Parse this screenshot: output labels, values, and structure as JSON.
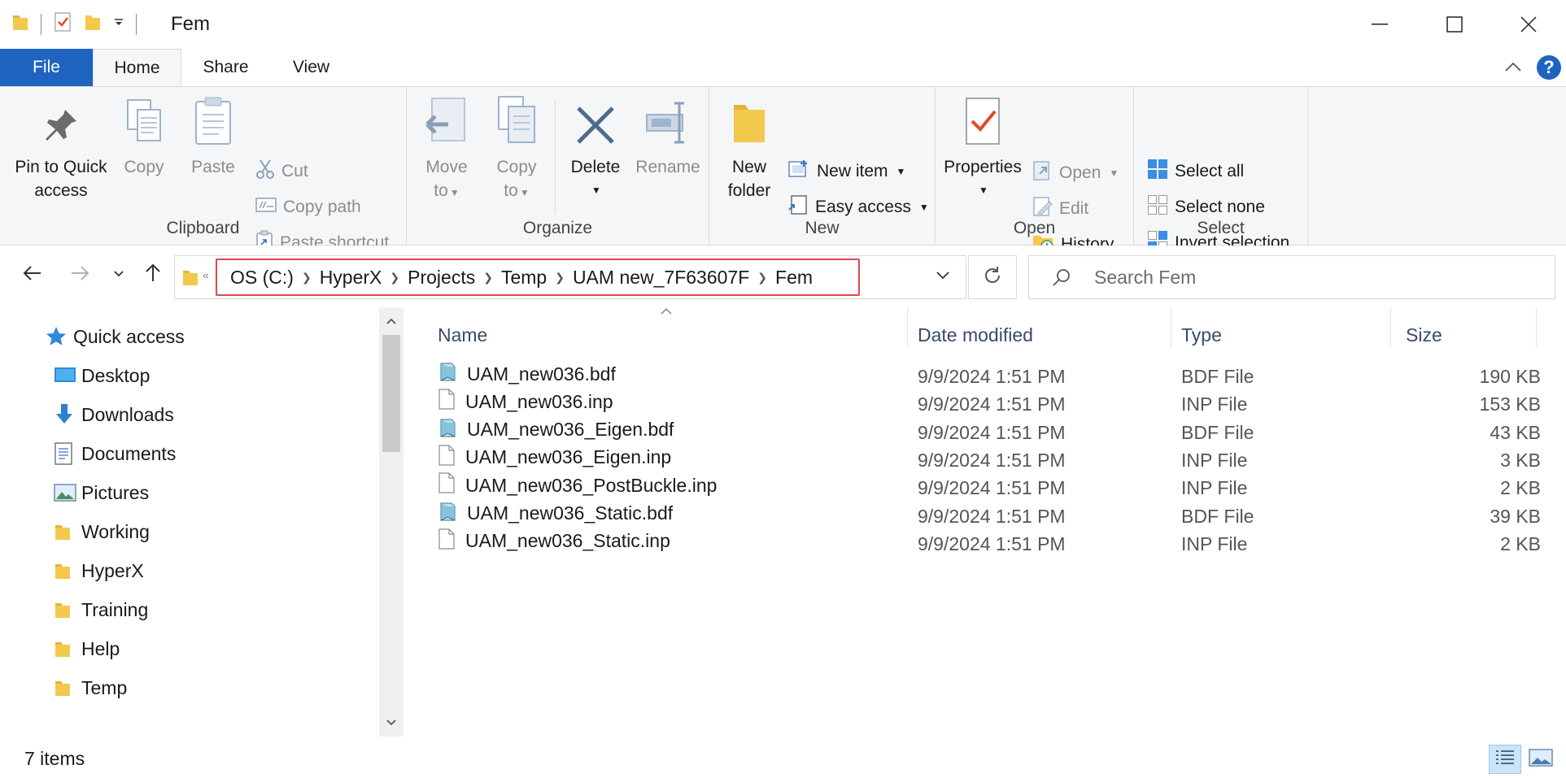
{
  "window": {
    "title": "Fem"
  },
  "tabs": {
    "file": "File",
    "home": "Home",
    "share": "Share",
    "view": "View"
  },
  "ribbon": {
    "clipboard": {
      "label": "Clipboard",
      "pin_line1": "Pin to Quick",
      "pin_line2": "access",
      "copy": "Copy",
      "paste": "Paste",
      "cut": "Cut",
      "copy_path": "Copy path",
      "paste_shortcut": "Paste shortcut"
    },
    "organize": {
      "label": "Organize",
      "move_line1": "Move",
      "move_line2": "to",
      "copy_line1": "Copy",
      "copy_line2": "to",
      "delete": "Delete",
      "rename": "Rename"
    },
    "new": {
      "label": "New",
      "new_folder_line1": "New",
      "new_folder_line2": "folder",
      "new_item": "New item",
      "easy_access": "Easy access"
    },
    "open": {
      "label": "Open",
      "properties": "Properties",
      "open": "Open",
      "edit": "Edit",
      "history": "History"
    },
    "select": {
      "label": "Select",
      "select_all": "Select all",
      "select_none": "Select none",
      "invert_selection": "Invert selection"
    }
  },
  "address": {
    "breadcrumbs": [
      "OS (C:)",
      "HyperX",
      "Projects",
      "Temp",
      "UAM new_7F63607F",
      "Fem"
    ]
  },
  "search": {
    "placeholder": "Search Fem"
  },
  "nav": {
    "quick_access": "Quick access",
    "items": [
      {
        "label": "Desktop",
        "icon": "desktop-icon"
      },
      {
        "label": "Downloads",
        "icon": "downloads-icon"
      },
      {
        "label": "Documents",
        "icon": "documents-icon"
      },
      {
        "label": "Pictures",
        "icon": "pictures-icon"
      },
      {
        "label": "Working",
        "icon": "folder-icon"
      },
      {
        "label": "HyperX",
        "icon": "folder-icon"
      },
      {
        "label": "Training",
        "icon": "folder-icon"
      },
      {
        "label": "Help",
        "icon": "folder-icon"
      },
      {
        "label": "Temp",
        "icon": "folder-icon"
      }
    ]
  },
  "columns": {
    "name": "Name",
    "date": "Date modified",
    "type": "Type",
    "size": "Size"
  },
  "files": [
    {
      "name": "UAM_new036.bdf",
      "date": "9/9/2024 1:51 PM",
      "type": "BDF File",
      "size": "190 KB",
      "icon": "bdf"
    },
    {
      "name": "UAM_new036.inp",
      "date": "9/9/2024 1:51 PM",
      "type": "INP File",
      "size": "153 KB",
      "icon": "inp"
    },
    {
      "name": "UAM_new036_Eigen.bdf",
      "date": "9/9/2024 1:51 PM",
      "type": "BDF File",
      "size": "43 KB",
      "icon": "bdf"
    },
    {
      "name": "UAM_new036_Eigen.inp",
      "date": "9/9/2024 1:51 PM",
      "type": "INP File",
      "size": "3 KB",
      "icon": "inp"
    },
    {
      "name": "UAM_new036_PostBuckle.inp",
      "date": "9/9/2024 1:51 PM",
      "type": "INP File",
      "size": "2 KB",
      "icon": "inp"
    },
    {
      "name": "UAM_new036_Static.bdf",
      "date": "9/9/2024 1:51 PM",
      "type": "BDF File",
      "size": "39 KB",
      "icon": "bdf"
    },
    {
      "name": "UAM_new036_Static.inp",
      "date": "9/9/2024 1:51 PM",
      "type": "INP File",
      "size": "2 KB",
      "icon": "inp"
    }
  ],
  "status": {
    "item_count": "7 items"
  },
  "colors": {
    "accent": "#1f64c0",
    "highlight_border": "#e0454c",
    "folder": "#f2c94c"
  }
}
